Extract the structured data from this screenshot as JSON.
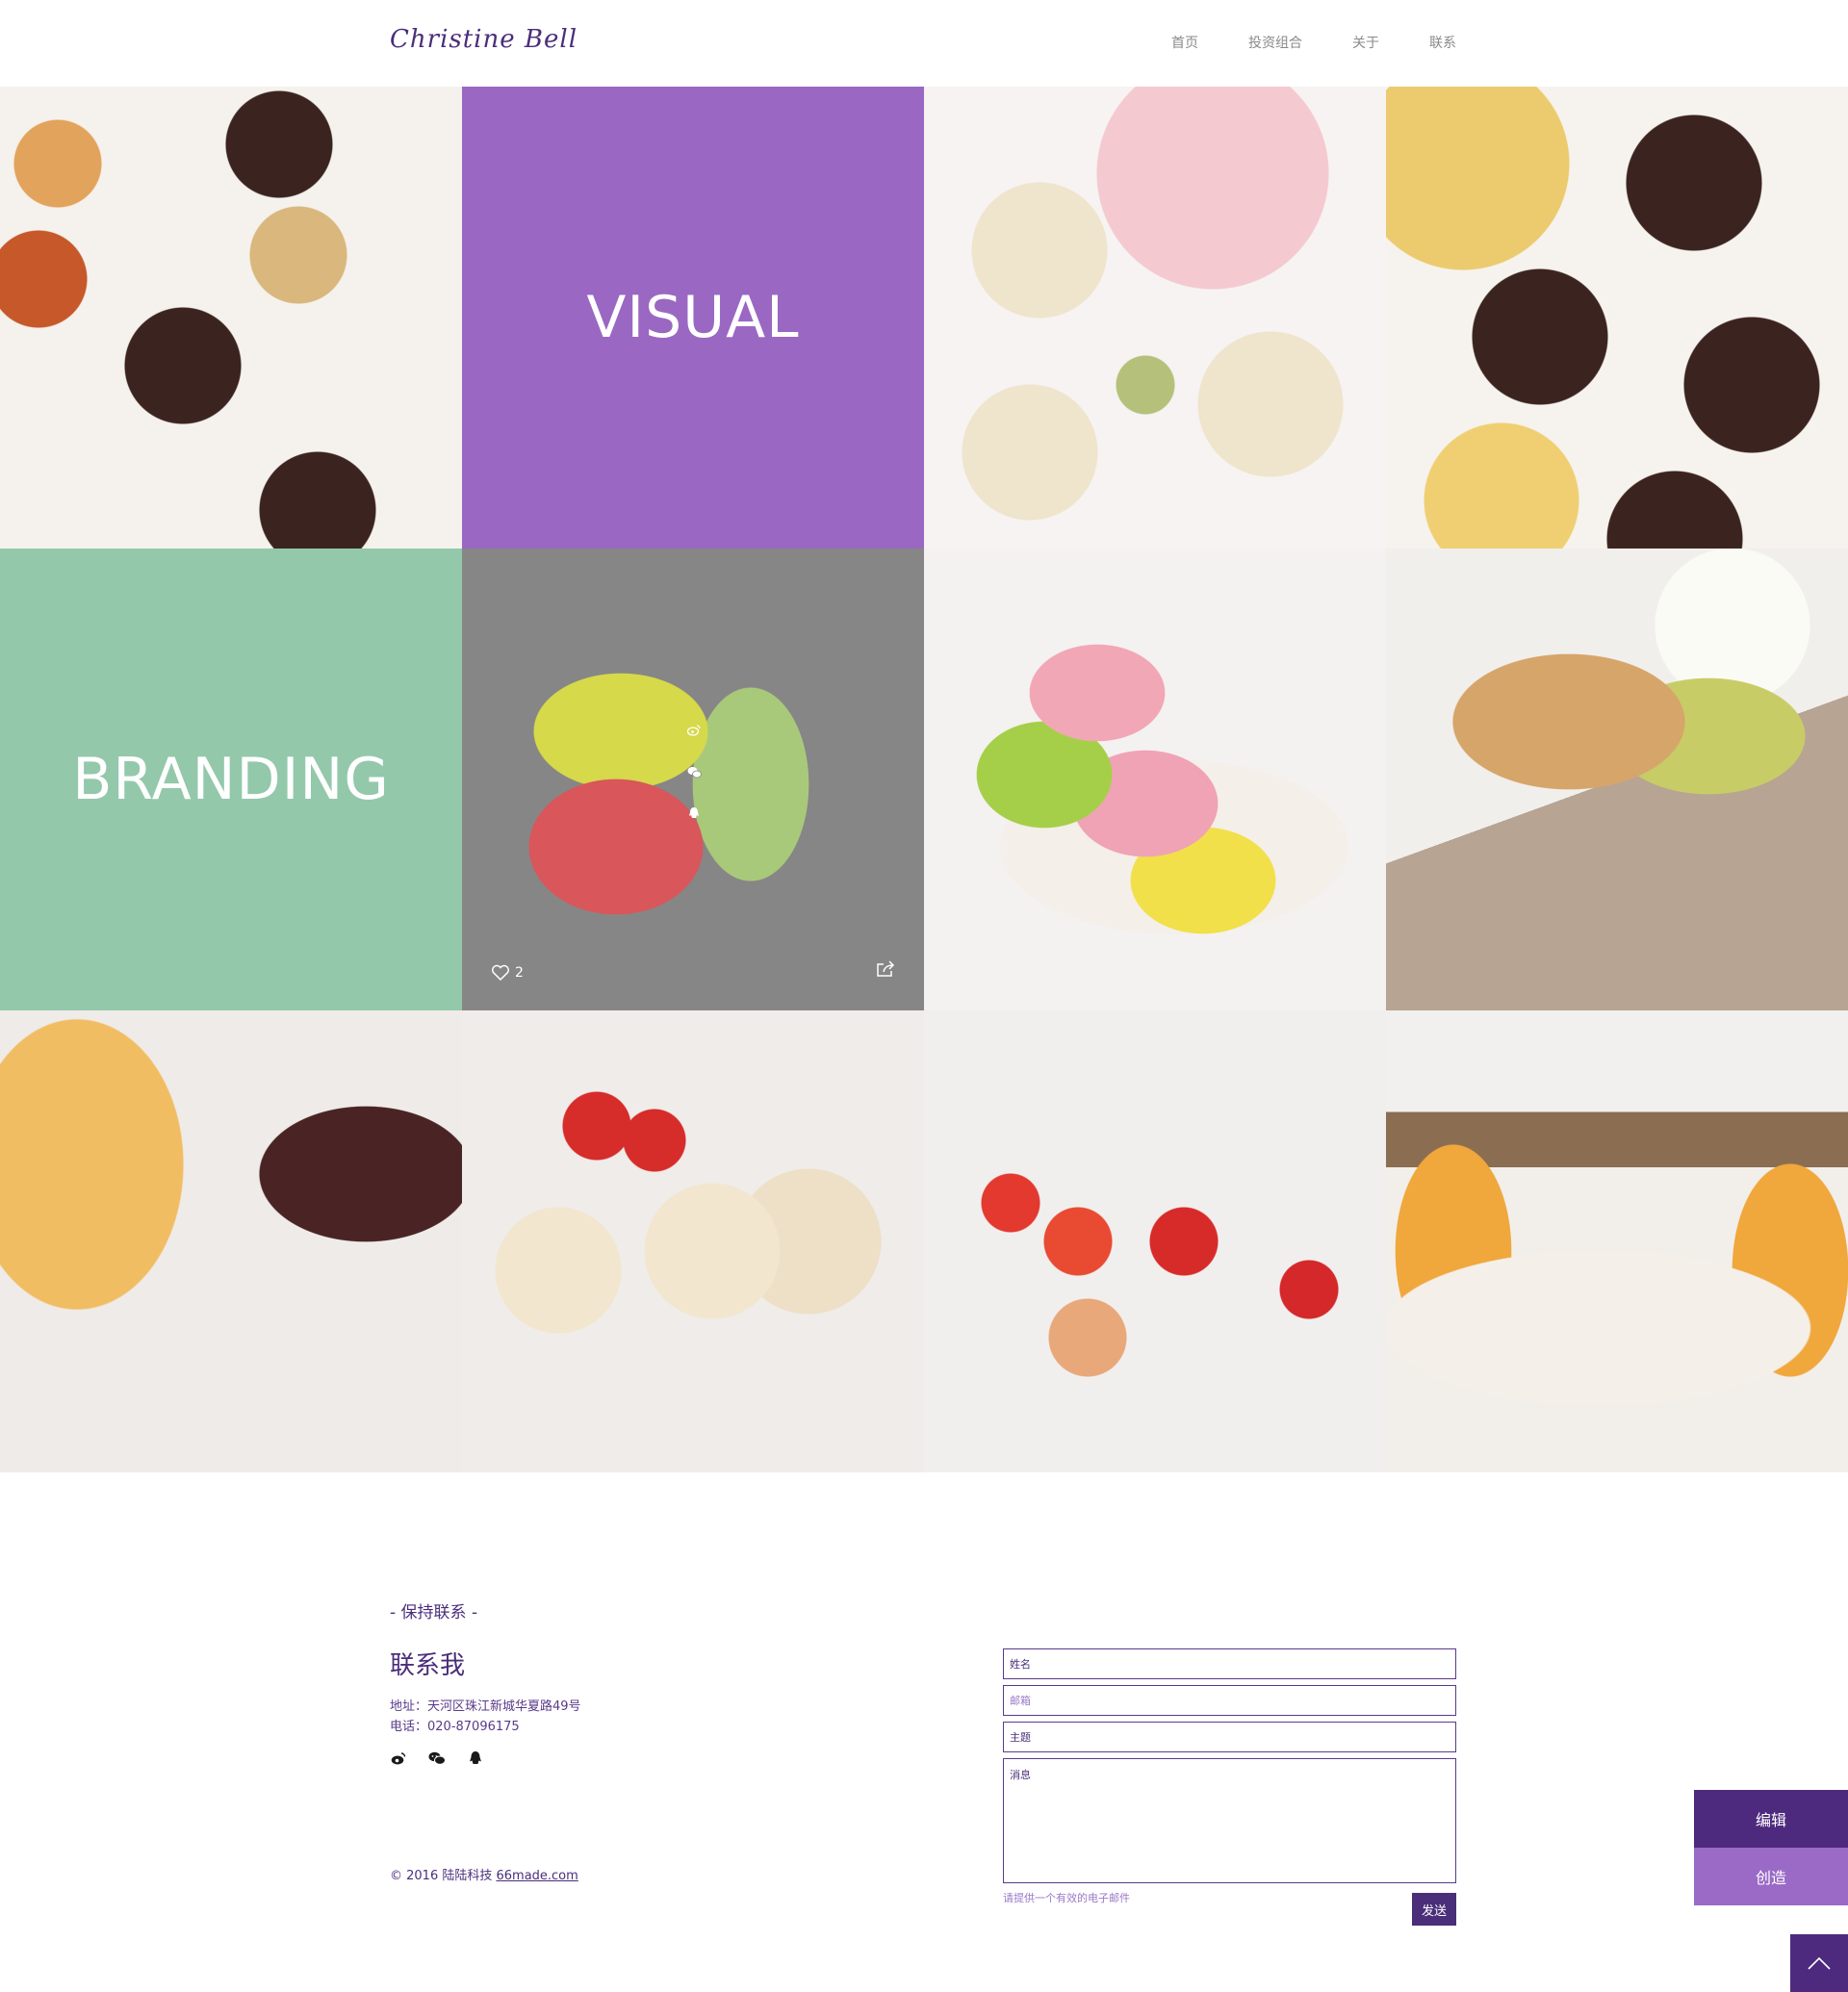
{
  "header": {
    "logo": "Christine Bell",
    "nav": [
      "首页",
      "投资组合",
      "关于",
      "联系"
    ]
  },
  "grid": {
    "visual_label": "VISUAL",
    "branding_label": "BRANDING",
    "like_count": "2"
  },
  "contact": {
    "eyebrow": "- 保持联系 -",
    "title": "联系我",
    "address": "地址：天河区珠江新城华夏路49号",
    "phone": "电话：020-87096175",
    "copyright_prefix": "© 2016 陆陆科技 ",
    "copyright_link": "66made.com"
  },
  "form": {
    "name_placeholder": "姓名",
    "email_placeholder": "邮箱",
    "subject_placeholder": "主题",
    "message_placeholder": "消息",
    "hint": "请提供一个有效的电子邮件",
    "send_label": "发送"
  },
  "side": {
    "edit_label": "编辑",
    "create_label": "创造"
  },
  "colors": {
    "brand_purple": "#4a2e7a",
    "visual_tile": "#9a68c2",
    "branding_tile": "#93c8ab"
  }
}
